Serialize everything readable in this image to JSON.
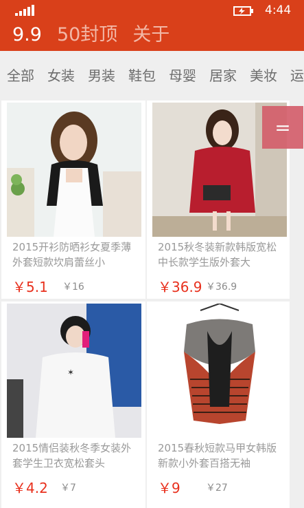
{
  "status_bar": {
    "time": "4:44"
  },
  "main_tabs": [
    {
      "label": "9.9",
      "active": true
    },
    {
      "label": "50封顶",
      "active": false
    },
    {
      "label": "关于",
      "active": false
    }
  ],
  "categories": [
    "全部",
    "女装",
    "男装",
    "鞋包",
    "母婴",
    "居家",
    "美妆",
    "运"
  ],
  "products": [
    {
      "title": "2015开衫防晒衫女夏季薄外套短款坎肩蕾丝小",
      "price": "￥5.1",
      "original": "￥16"
    },
    {
      "title": "2015秋冬装新款韩版宽松中长款学生版外套大",
      "price": "￥36.9",
      "original": "￥36.9"
    },
    {
      "title": "2015情侣装秋冬季女装外套学生卫衣宽松套头",
      "price": "￥4.2",
      "original": "￥7"
    },
    {
      "title": "2015春秋短款马甲女韩版新款小外套百搭无袖",
      "price": "￥9",
      "original": "￥27"
    }
  ],
  "float_button": {
    "label": "="
  },
  "colors": {
    "accent": "#d9401a",
    "price": "#e8301d",
    "inactive_tab": "#f2b7a6"
  },
  "icons": {
    "signal": "signal-strength-icon",
    "battery": "battery-charging-icon",
    "menu": "menu-icon"
  }
}
